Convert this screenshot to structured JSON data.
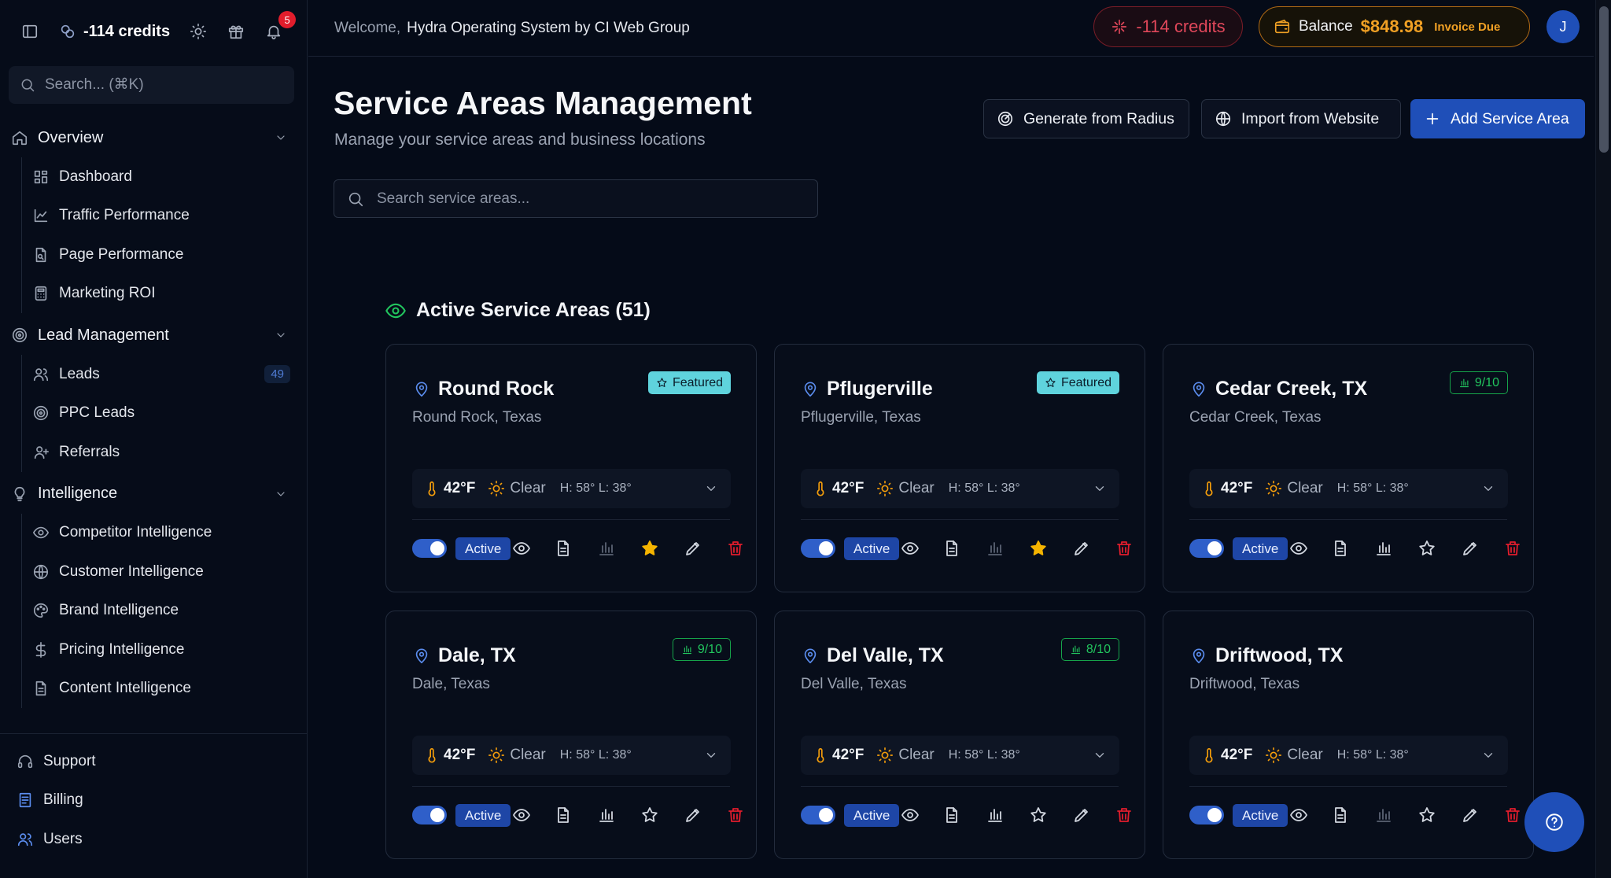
{
  "topbar": {
    "credits": "-114 credits",
    "notifications_count": "5"
  },
  "sidebar": {
    "search_placeholder": "Search... (⌘K)",
    "sections": [
      {
        "title": "Overview",
        "items": [
          {
            "label": "Dashboard"
          },
          {
            "label": "Traffic Performance"
          },
          {
            "label": "Page Performance"
          },
          {
            "label": "Marketing ROI"
          }
        ]
      },
      {
        "title": "Lead Management",
        "items": [
          {
            "label": "Leads",
            "count": "49"
          },
          {
            "label": "PPC Leads"
          },
          {
            "label": "Referrals"
          }
        ]
      },
      {
        "title": "Intelligence",
        "items": [
          {
            "label": "Competitor Intelligence"
          },
          {
            "label": "Customer Intelligence"
          },
          {
            "label": "Brand Intelligence"
          },
          {
            "label": "Pricing Intelligence"
          },
          {
            "label": "Content Intelligence"
          }
        ]
      }
    ],
    "bottom": [
      {
        "label": "Support"
      },
      {
        "label": "Billing"
      },
      {
        "label": "Users"
      }
    ]
  },
  "header": {
    "welcome": "Welcome,",
    "org_name": "Hydra Operating System by CI Web Group",
    "credits": "-114 credits",
    "balance_label": "Balance",
    "balance_amount": "$848.98",
    "invoice_status": "Invoice Due",
    "avatar_initial": "J"
  },
  "main": {
    "title": "Service Areas Management",
    "subtitle": "Manage your service areas and business locations",
    "buttons": {
      "generate": "Generate from Radius",
      "import": "Import from Website",
      "add": "Add Service Area"
    },
    "search_placeholder": "Search service areas...",
    "active_heading": "Active Service Areas (51)"
  },
  "cards": [
    {
      "name": "Round Rock",
      "location": "Round Rock, Texas",
      "tag": "Featured",
      "tag_type": "featured",
      "temp": "42°F",
      "condition": "Clear",
      "hilo": "H: 58° L: 38°",
      "status": "Active",
      "starred": true,
      "stats_dim": true
    },
    {
      "name": "Pflugerville",
      "location": "Pflugerville, Texas",
      "tag": "Featured",
      "tag_type": "featured",
      "temp": "42°F",
      "condition": "Clear",
      "hilo": "H: 58° L: 38°",
      "status": "Active",
      "starred": true,
      "stats_dim": true
    },
    {
      "name": "Cedar Creek, TX",
      "location": "Cedar Creek, Texas",
      "tag": "9/10",
      "tag_type": "score",
      "temp": "42°F",
      "condition": "Clear",
      "hilo": "H: 58° L: 38°",
      "status": "Active",
      "starred": false,
      "stats_dim": false
    },
    {
      "name": "Dale, TX",
      "location": "Dale, Texas",
      "tag": "9/10",
      "tag_type": "score",
      "temp": "42°F",
      "condition": "Clear",
      "hilo": "H: 58° L: 38°",
      "status": "Active",
      "starred": false,
      "stats_dim": false
    },
    {
      "name": "Del Valle, TX",
      "location": "Del Valle, Texas",
      "tag": "8/10",
      "tag_type": "score",
      "temp": "42°F",
      "condition": "Clear",
      "hilo": "H: 58° L: 38°",
      "status": "Active",
      "starred": false,
      "stats_dim": false
    },
    {
      "name": "Driftwood, TX",
      "location": "Driftwood, Texas",
      "tag": "",
      "tag_type": "none",
      "temp": "42°F",
      "condition": "Clear",
      "hilo": "H: 58° L: 38°",
      "status": "Active",
      "starred": false,
      "stats_dim": true
    }
  ],
  "colors": {
    "accent": "#1f4fb8",
    "featured": "#5fd3dd",
    "score": "#22c55e",
    "danger": "#e11d2c",
    "warning": "#f0a024"
  }
}
